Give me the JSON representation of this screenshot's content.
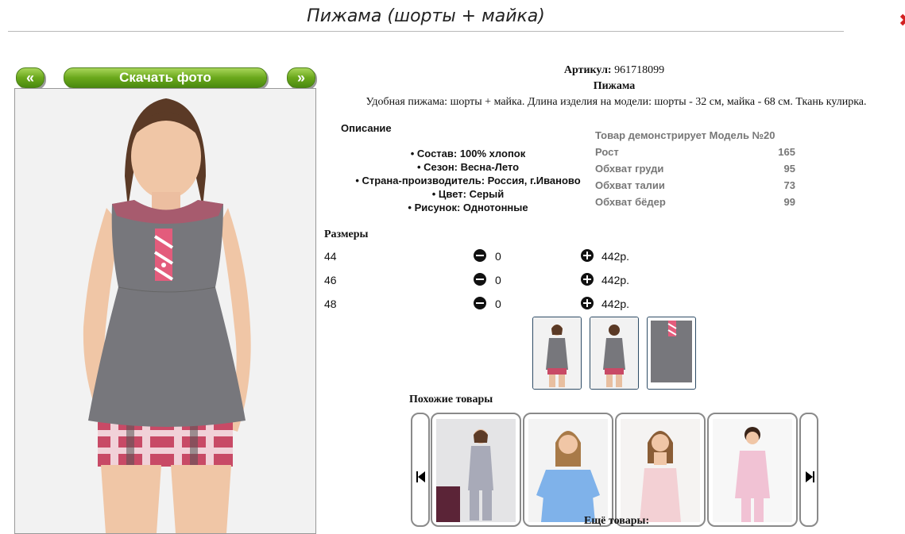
{
  "page_title": "Пижама (шорты + майка)",
  "nav": {
    "prev_label": "«",
    "download_label": "Скачать фото",
    "next_label": "»"
  },
  "product": {
    "article_label": "Артикул:",
    "article_value": "961718099",
    "name": "Пижама",
    "description": "Удобная пижама: шорты + майка. Длина изделия на модели: шорты - 32 см, майка - 68 см. Ткань кулирка."
  },
  "description_heading": "Описание",
  "specs": [
    "Состав: 100% хлопок",
    "Сезон: Весна-Лето",
    "Страна-производитель: Россия, г.Иваново",
    "Цвет: Серый",
    "Рисунок: Однотонные"
  ],
  "model": {
    "title": "Товар демонстрирует Модель №20",
    "rows": [
      {
        "label": "Рост",
        "value": "165"
      },
      {
        "label": "Обхват груди",
        "value": "95"
      },
      {
        "label": "Обхват талии",
        "value": "73"
      },
      {
        "label": "Обхват бёдер",
        "value": "99"
      }
    ]
  },
  "sizes_heading": "Размеры",
  "sizes": [
    {
      "size": "44",
      "qty": "0",
      "price": "442р."
    },
    {
      "size": "46",
      "qty": "0",
      "price": "442р."
    },
    {
      "size": "48",
      "qty": "0",
      "price": "442р."
    }
  ],
  "similar_heading": "Похожие товары",
  "more_label": "Ещё товары:",
  "colors": {
    "accent_green": "#6aa81c",
    "close_red": "#d32020",
    "thumb_border": "#2e4c66"
  }
}
